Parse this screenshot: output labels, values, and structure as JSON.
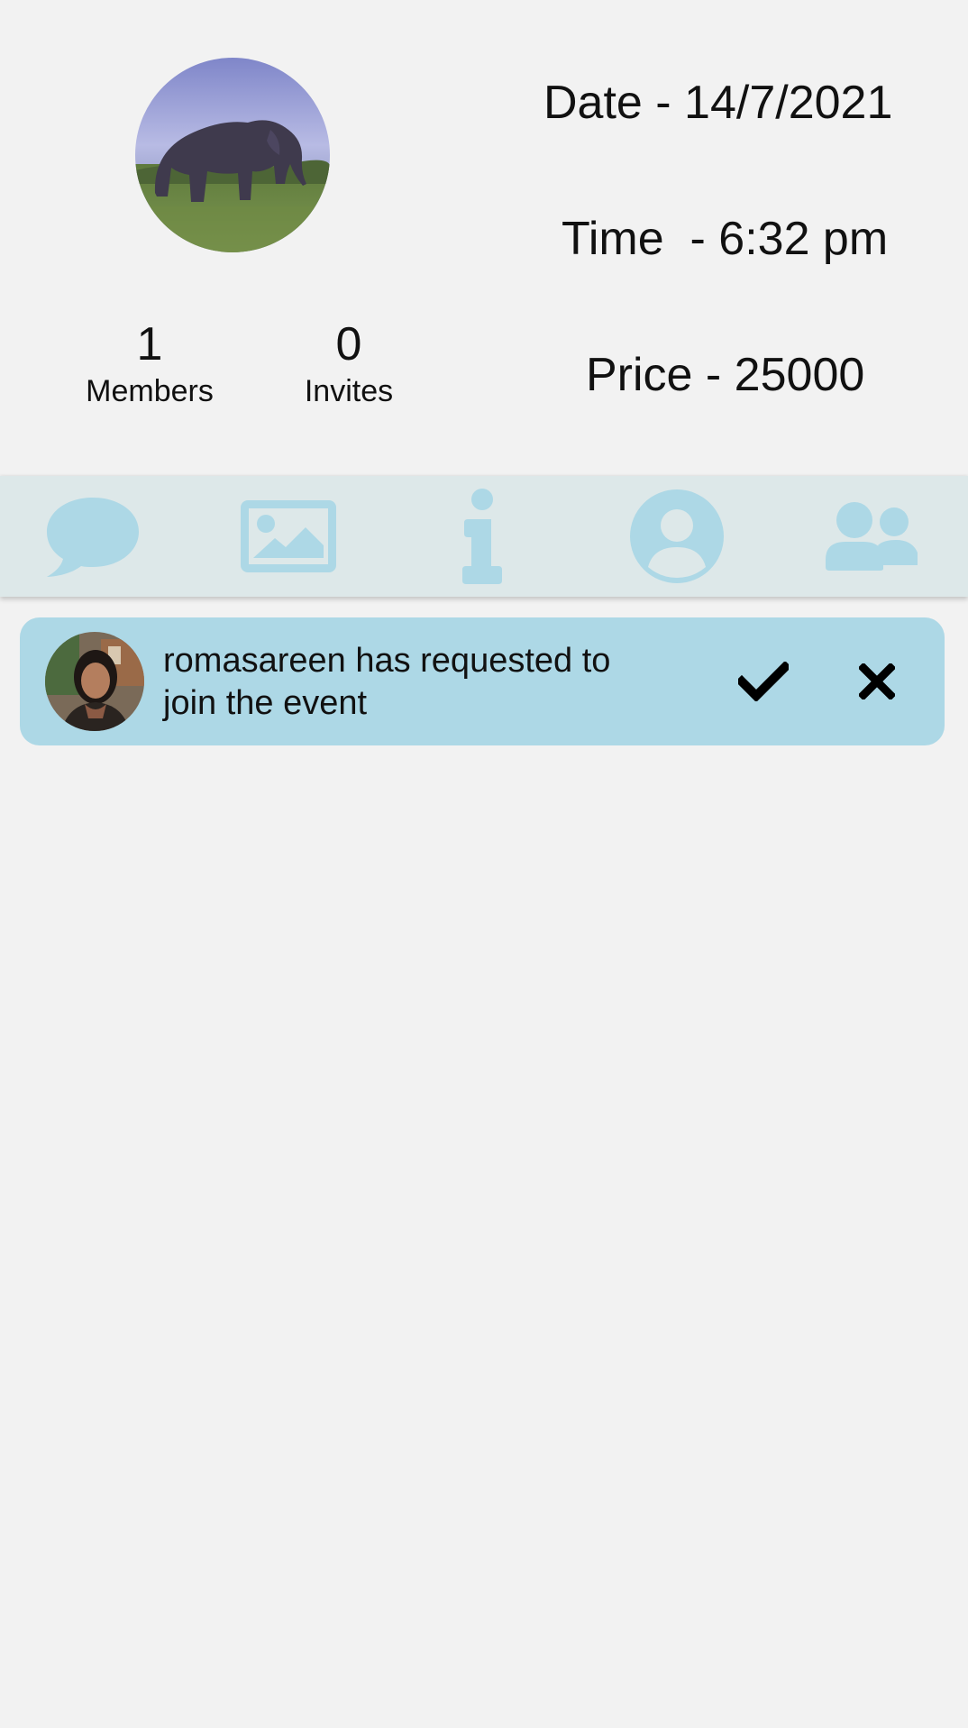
{
  "event": {
    "members_count": "1",
    "members_label": "Members",
    "invites_count": "0",
    "invites_label": "Invites",
    "date_text": "Date - 14/7/2021",
    "time_text": "Time  - 6:32 pm",
    "price_text": "Price - 25000",
    "avatar_icon": "elephant-photo"
  },
  "tabs": [
    {
      "icon": "chat-bubble-icon"
    },
    {
      "icon": "image-icon"
    },
    {
      "icon": "info-icon"
    },
    {
      "icon": "user-circle-icon"
    },
    {
      "icon": "users-icon"
    }
  ],
  "request": {
    "avatar_icon": "user-photo",
    "message": "romasareen has requested to join the event",
    "accept_icon": "check-icon",
    "reject_icon": "close-icon"
  },
  "colors": {
    "background": "#f2f2f2",
    "tabbar": "#dde8e9",
    "tab_icon": "#add8e6",
    "card": "#add8e6",
    "text": "#111111"
  }
}
